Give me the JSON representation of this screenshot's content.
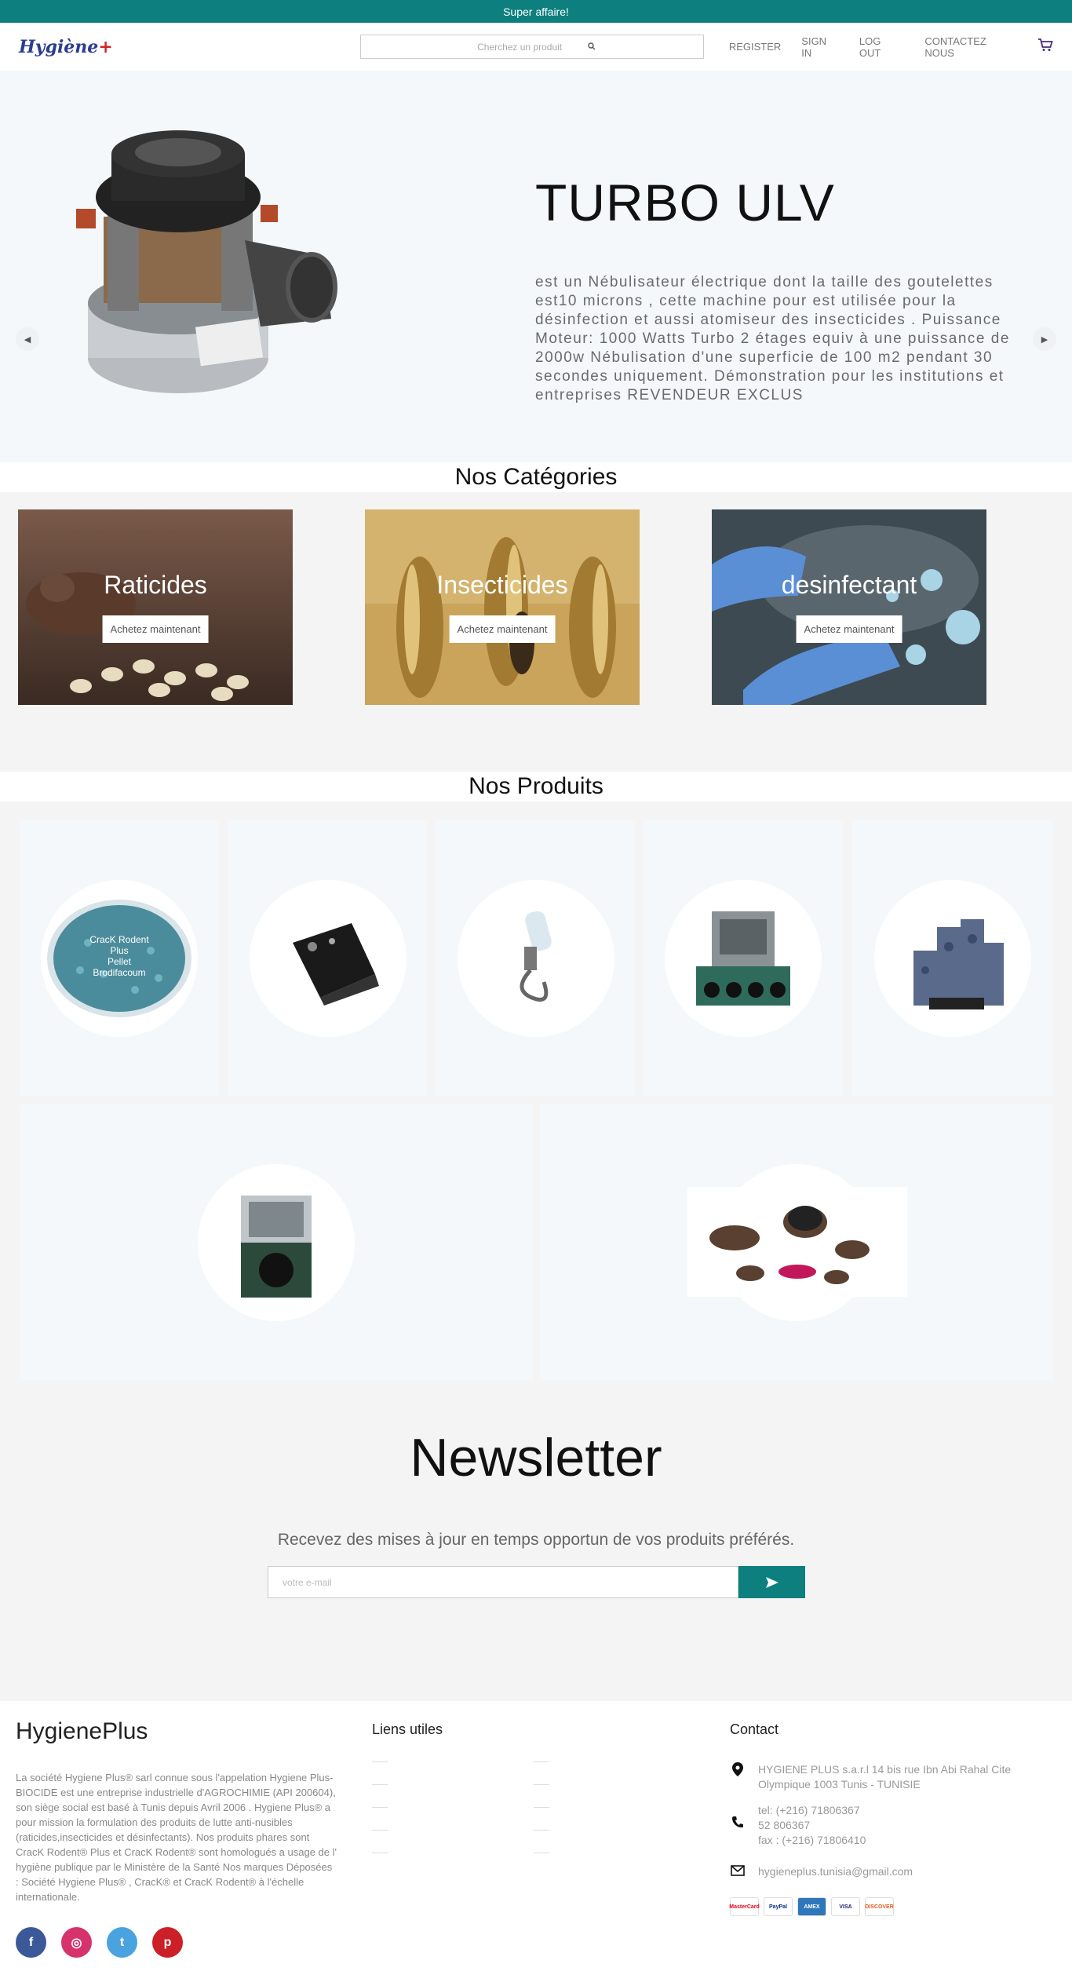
{
  "topbar": {
    "promo": "Super affaire!"
  },
  "header": {
    "logo_text": "Hygiène",
    "logo_plus": "+",
    "search_placeholder": "Cherchez un produit",
    "nav": [
      "REGISTER",
      "SIGN IN",
      "LOG OUT",
      "CONTACTEZ NOUS"
    ]
  },
  "hero": {
    "title": "TURBO ULV",
    "description": "est un Nébulisateur électrique dont la taille des goutelettes est10 microns , cette machine pour est utilisée pour la désinfection et aussi atomiseur des insecticides . Puissance Moteur: 1000 Watts Turbo 2 étages equiv à une puissance de 2000w Nébulisation d'une superficie de 100 m2 pendant 30 secondes uniquement. Démonstration pour les institutions et entreprises REVENDEUR EXCLUS"
  },
  "categories": {
    "title": "Nos Catégories",
    "items": [
      {
        "label": "Raticides",
        "button": "Achetez maintenant"
      },
      {
        "label": "Insecticides",
        "button": "Achetez maintenant"
      },
      {
        "label": "desinfectant",
        "button": "Achetez maintenant"
      }
    ]
  },
  "products": {
    "title": "Nos Produits",
    "crack_label": [
      "CracK Rodent",
      "Plus",
      "Pellet",
      "Brodifacoum"
    ]
  },
  "newsletter": {
    "title": "Newsletter",
    "subtitle": "Recevez des mises à jour en temps opportun de vos produits préférés.",
    "email_placeholder": "votre e-mail"
  },
  "footer": {
    "brand": "HygienePlus",
    "about": "La société Hygiene Plus® sarl connue sous l'appelation Hygiene Plus- BIOCIDE est une entreprise industrielle d'AGROCHIMIE (API 200604), son siège social est basé à Tunis depuis Avril 2006 . Hygiene Plus® a pour mission la formulation des produits de lutte anti-nusibles (raticides,insecticides et désinfectants). Nos produits phares sont CracK Rodent® Plus et CracK Rodent® sont homologués a usage de l' hygiène publique par le Ministère de la Santé Nos marques Déposées : Société Hygiene Plus® , CracK® et CracK Rodent® à l'échelle internationale.",
    "links_title": "Liens utiles",
    "contact_title": "Contact",
    "address": "HYGIENE PLUS s.a.r.l 14 bis rue Ibn Abi Rahal Cite Olympique 1003 Tunis - TUNISIE",
    "tel1": "tel: (+216) 71806367",
    "tel2": "52 806367",
    "fax": "fax : (+216) 71806410",
    "email": "hygieneplus.tunisia@gmail.com",
    "social_icons": [
      "facebook-icon",
      "instagram-icon",
      "twitter-icon",
      "pinterest-icon"
    ],
    "payments": [
      "MasterCard",
      "PayPal",
      "AMEX",
      "VISA",
      "DISCOVER"
    ]
  },
  "colors": {
    "primary": "#0d7f7f",
    "facebook": "#3b5998",
    "instagram": "#d6336c",
    "twitter": "#4aa3df",
    "pinterest": "#cb2027"
  }
}
